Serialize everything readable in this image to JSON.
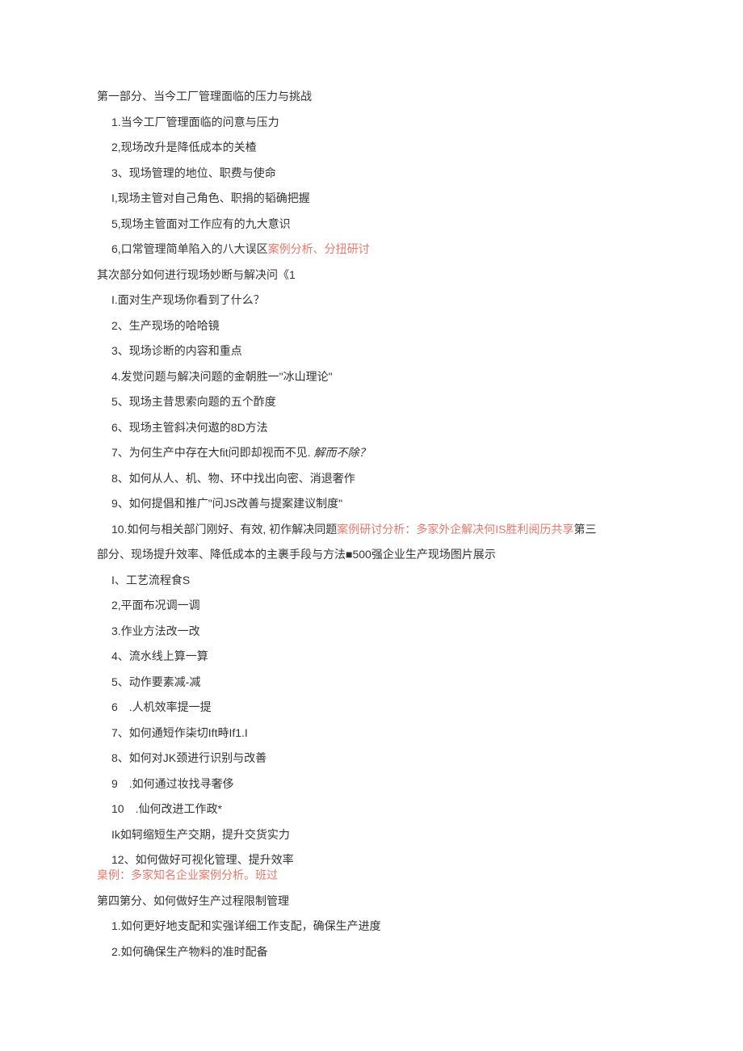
{
  "section1": {
    "heading": "第一部分、当今工厂管理面临的压力与挑战",
    "items": [
      "1.当今工厂管理面临的问意与压力",
      "2,现场改升是降低成本的关楂",
      "3、现场管理的地位、职费与使命",
      "I,现场主管对自己角色、职捐的韬确把握",
      "5,现场主管面对工作应有的九大意识"
    ],
    "item6_prefix": "6,口常管理简单陷入的八大误区",
    "item6_red": "案例分析、分扭研讨"
  },
  "section2": {
    "heading": "其次部分如何进行现场妙断与解决问《1",
    "items": [
      "I.面对生产现场你看到了什么？",
      "2、生产现场的哈哈镜",
      "3、现场诊断的内容和重点",
      "4.发觉问题与解决问题的金朝胜一\"冰山理论\"",
      "5、现场主昔思索向题的五个酢度",
      "6、现场主管斜决何遨的8D方法"
    ],
    "item7_prefix": "7、为何生产中存在大fit问即却视而不见. ",
    "item7_italic": "解而不除？",
    "items_b": [
      "8、如何从人、机、物、环中找出向密、消退奢作",
      "9、如何提倡和推广\"问JS改善与提案建议制度\""
    ],
    "item10_prefix": "10.如何与相关部门刚好、有效, 初作解决同题",
    "item10_red": "案例研讨分析：多家外企解决何IS胜利阅历共享",
    "item10_suffix": "第三"
  },
  "section3": {
    "heading_tail": "部分、现场提升效率、降低成本的主裹手段与方法■500强企业生产现场图片展示",
    "items": [
      "I、工艺流程食S",
      "2,平面布况调一调",
      "3.作业方法改一改",
      "4、流水线上算一算",
      "5、动作要素减-减",
      "6 .人机效率提一提",
      "7、如何通短作柒切Ift畤If1.I",
      "8、如何对JK颈进行识别与改善",
      "9 .如何通过妆找寻奢侈",
      "10 .仙何改进工作政*",
      "Ik如轲缩短生产交期，提升交货实力",
      "12、如何做好可视化管理、提升效率"
    ],
    "case_red": "臬例：多家知名企业案例分析。班过"
  },
  "section4": {
    "heading": "第四第分、如何做好生产过程限制管理",
    "items": [
      "1.如何更好地支配和实强详细工作支配，确保生产进度",
      "2.如何确保生产物料的准时配备"
    ]
  }
}
